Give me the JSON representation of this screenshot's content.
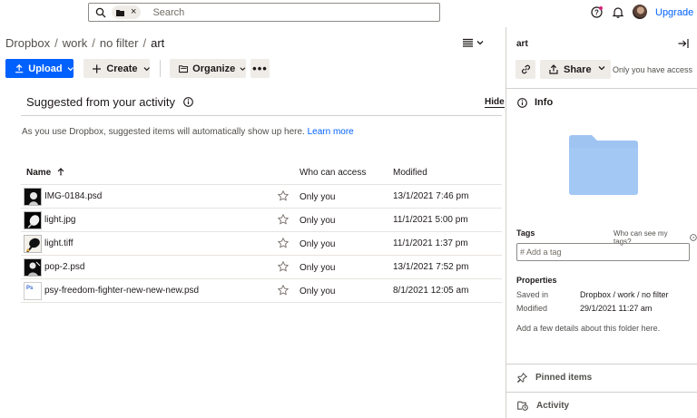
{
  "search": {
    "placeholder": "Search"
  },
  "header": {
    "upgrade_label": "Upgrade"
  },
  "breadcrumb": [
    "Dropbox",
    "work",
    "no filter",
    "art"
  ],
  "toolbar": {
    "upload_label": "Upload",
    "create_label": "Create",
    "organize_label": "Organize",
    "more_label": "•••"
  },
  "suggested": {
    "title": "Suggested from your activity",
    "hide_label": "Hide",
    "message": "As you use Dropbox, suggested items will automatically show up here.",
    "learn_more": "Learn more"
  },
  "table": {
    "col_name": "Name",
    "col_access": "Who can access",
    "col_modified": "Modified",
    "rows": [
      {
        "name": "IMG-0184.psd",
        "access": "Only you",
        "modified": "13/1/2021 7:46 pm",
        "thumb": "image"
      },
      {
        "name": "light.jpg",
        "access": "Only you",
        "modified": "11/1/2021 5:00 pm",
        "thumb": "image"
      },
      {
        "name": "light.tiff",
        "access": "Only you",
        "modified": "11/1/2021 1:37 pm",
        "thumb": "image"
      },
      {
        "name": "pop-2.psd",
        "access": "Only you",
        "modified": "13/1/2021 7:52 pm",
        "thumb": "image"
      },
      {
        "name": "psy-freedom-fighter-new-new-new.psd",
        "access": "Only you",
        "modified": "8/1/2021 12:05 am",
        "thumb": "psd"
      }
    ]
  },
  "panel": {
    "title": "art",
    "share_label": "Share",
    "access_text": "Only you have access",
    "info_label": "Info",
    "tags_label": "Tags",
    "who_can_see_tags": "Who can see my tags?",
    "tag_placeholder": "# Add a tag",
    "properties_label": "Properties",
    "saved_in_label": "Saved in",
    "saved_in_value": "Dropbox  /  work  /  no filter",
    "modified_label": "Modified",
    "modified_value": "29/1/2021 11:27 am",
    "add_details": "Add a few details about this folder here.",
    "pinned_label": "Pinned items",
    "activity_label": "Activity"
  },
  "colors": {
    "accent": "#0061fe",
    "folder": "#a0c4f2",
    "notification": "#d6247a"
  }
}
